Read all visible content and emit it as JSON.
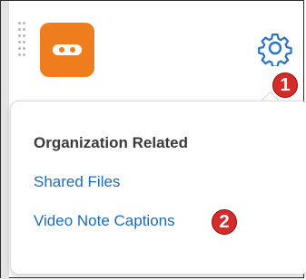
{
  "colors": {
    "brand_orange": "#f07d1d",
    "link_blue": "#1a6bb8",
    "badge_red": "#d52b2b",
    "gear_blue": "#2a73c2"
  },
  "toolbar": {
    "app_icon": "orange-tile-icon",
    "settings_icon": "gear-icon"
  },
  "annotations": {
    "badge_1": "1",
    "badge_2": "2"
  },
  "menu": {
    "section_heading": "Organization Related",
    "items": [
      {
        "label": "Shared Files"
      },
      {
        "label": "Video Note Captions"
      }
    ]
  }
}
